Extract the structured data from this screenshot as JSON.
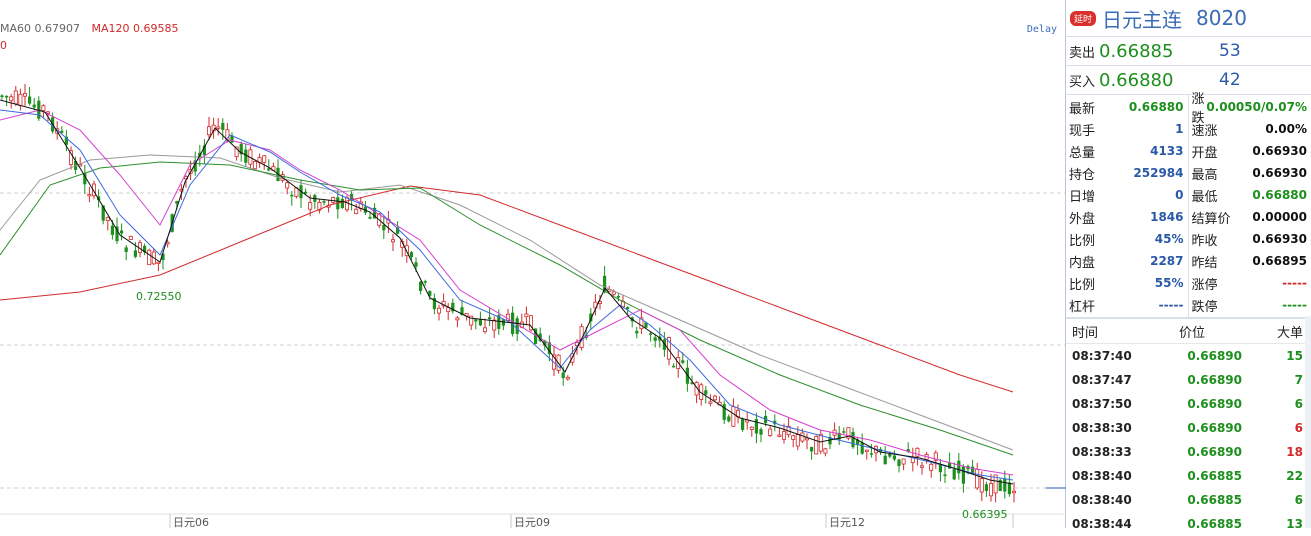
{
  "chart": {
    "ma_legend": [
      {
        "label": "MA60 0.67907",
        "color": "#666666"
      },
      {
        "label": "MA120 0.69585",
        "color": "#d22a2a"
      }
    ],
    "zero_label": "0",
    "delay_link": "Delay",
    "x_labels": [
      "日元06",
      "日元09",
      "日元12"
    ],
    "annotations": {
      "high_label": "0.72550",
      "low_label": "0.66395"
    },
    "colors": {
      "up": "#d22a2a",
      "down": "#1d8f1d",
      "ma5": "#111111",
      "ma10": "#3a6bdc",
      "ma20": "#d63fd0",
      "ma60_green": "#2b8f2b",
      "ma60": "#999999",
      "ma120": "#d22a2a",
      "grid": "#cfcfcf"
    }
  },
  "panel": {
    "delay_badge": "延时",
    "name": "日元主连",
    "code": "8020",
    "sell": {
      "label": "卖出",
      "price": "0.66885",
      "volume": "53"
    },
    "buy": {
      "label": "买入",
      "price": "0.66880",
      "volume": "42"
    },
    "stats_left": [
      {
        "label": "最新",
        "value": "0.66880",
        "color": "green"
      },
      {
        "label": "现手",
        "value": "1",
        "color": "blue"
      },
      {
        "label": "总量",
        "value": "4133",
        "color": "blue"
      },
      {
        "label": "持仓",
        "value": "252984",
        "color": "blue"
      },
      {
        "label": "日增",
        "value": "0",
        "color": "blue"
      },
      {
        "label": "外盘",
        "value": "1846",
        "color": "blue"
      },
      {
        "label": "比例",
        "value": "45%",
        "color": "blue"
      },
      {
        "label": "内盘",
        "value": "2287",
        "color": "blue"
      },
      {
        "label": "比例",
        "value": "55%",
        "color": "blue"
      },
      {
        "label": "杠杆",
        "value": "-----",
        "color": "blue"
      }
    ],
    "stats_right": [
      {
        "label": "涨跌",
        "value": "0.00050/0.07%",
        "color": "green"
      },
      {
        "label": "速涨",
        "value": "0.00%",
        "color": "black"
      },
      {
        "label": "开盘",
        "value": "0.66930",
        "color": "black"
      },
      {
        "label": "最高",
        "value": "0.66930",
        "color": "black"
      },
      {
        "label": "最低",
        "value": "0.66880",
        "color": "green"
      },
      {
        "label": "结算价",
        "value": "0.00000",
        "color": "black"
      },
      {
        "label": "昨收",
        "value": "0.66930",
        "color": "black"
      },
      {
        "label": "昨结",
        "value": "0.66895",
        "color": "black"
      },
      {
        "label": "涨停",
        "value": "-----",
        "color": "red"
      },
      {
        "label": "跌停",
        "value": "-----",
        "color": "green"
      }
    ],
    "tick_headers": {
      "time": "时间",
      "price": "价位",
      "volume": "大单"
    },
    "ticks": [
      {
        "time": "08:37:40",
        "price": "0.66890",
        "volume": "15",
        "vcolor": "green"
      },
      {
        "time": "08:37:47",
        "price": "0.66890",
        "volume": "7",
        "vcolor": "green"
      },
      {
        "time": "08:37:50",
        "price": "0.66890",
        "volume": "6",
        "vcolor": "green"
      },
      {
        "time": "08:38:30",
        "price": "0.66890",
        "volume": "6",
        "vcolor": "red"
      },
      {
        "time": "08:38:33",
        "price": "0.66890",
        "volume": "18",
        "vcolor": "red"
      },
      {
        "time": "08:38:40",
        "price": "0.66885",
        "volume": "22",
        "vcolor": "green"
      },
      {
        "time": "08:38:40",
        "price": "0.66885",
        "volume": "6",
        "vcolor": "green"
      },
      {
        "time": "08:38:44",
        "price": "0.66885",
        "volume": "13",
        "vcolor": "green"
      }
    ]
  }
}
